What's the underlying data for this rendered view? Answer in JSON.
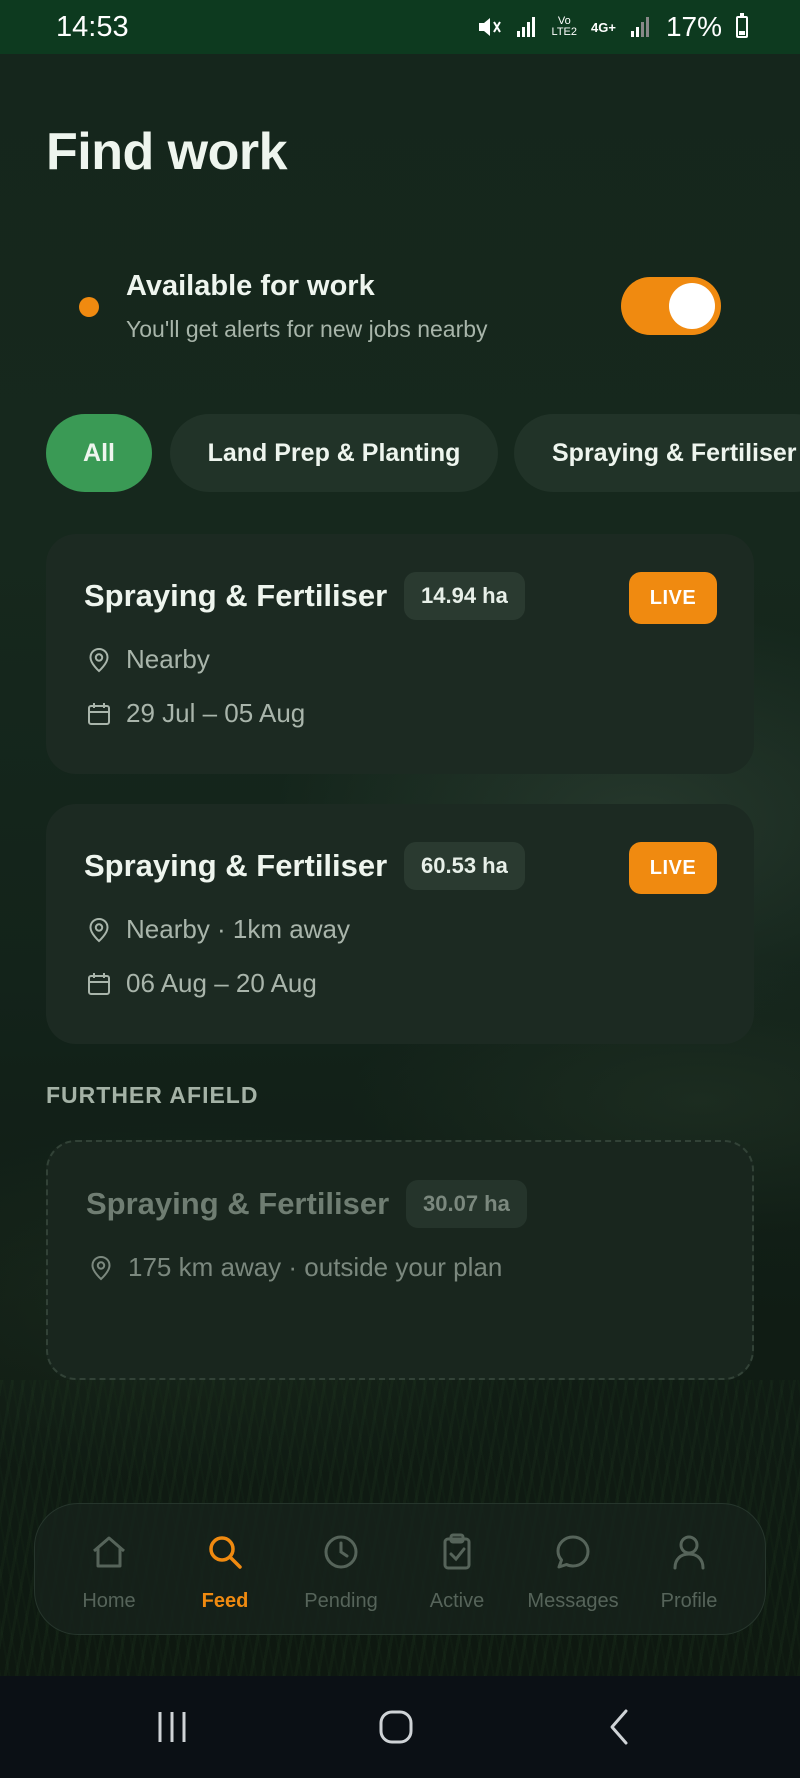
{
  "status_bar": {
    "time": "14:53",
    "network_top": "Vo",
    "network_bottom": "LTE2",
    "network_type": "4G+",
    "battery": "17%",
    "icons": [
      "mute-icon",
      "signal-icon",
      "signal-icon",
      "battery-icon"
    ]
  },
  "page": {
    "title": "Find work"
  },
  "availability": {
    "title": "Available for work",
    "subtitle": "You'll get alerts for new jobs nearby",
    "enabled": true
  },
  "filters": [
    {
      "label": "All",
      "active": true
    },
    {
      "label": "Land Prep & Planting",
      "active": false
    },
    {
      "label": "Spraying & Fertiliser",
      "active": false
    }
  ],
  "jobs": [
    {
      "title": "Spraying & Fertiliser",
      "area": "14.94 ha",
      "badge": "LIVE",
      "location": "Nearby",
      "dates": "29 Jul – 05 Aug"
    },
    {
      "title": "Spraying & Fertiliser",
      "area": "60.53 ha",
      "badge": "LIVE",
      "location": "Nearby · 1km away",
      "dates": "06 Aug – 20 Aug"
    }
  ],
  "further_afield": {
    "label": "FURTHER AFIELD",
    "jobs": [
      {
        "title": "Spraying & Fertiliser",
        "area": "30.07 ha",
        "location": "175 km away · outside your plan"
      }
    ]
  },
  "bottom_nav": [
    {
      "label": "Home",
      "icon": "home-icon",
      "active": false
    },
    {
      "label": "Feed",
      "icon": "search-icon",
      "active": true
    },
    {
      "label": "Pending",
      "icon": "clock-icon",
      "active": false
    },
    {
      "label": "Active",
      "icon": "clipboard-check-icon",
      "active": false
    },
    {
      "label": "Messages",
      "icon": "chat-icon",
      "active": false
    },
    {
      "label": "Profile",
      "icon": "user-icon",
      "active": false
    }
  ],
  "colors": {
    "accent": "#f08a10",
    "chip_active": "#3a9a55",
    "status_bar": "#0d3a1f",
    "card": "#1c2a22"
  }
}
